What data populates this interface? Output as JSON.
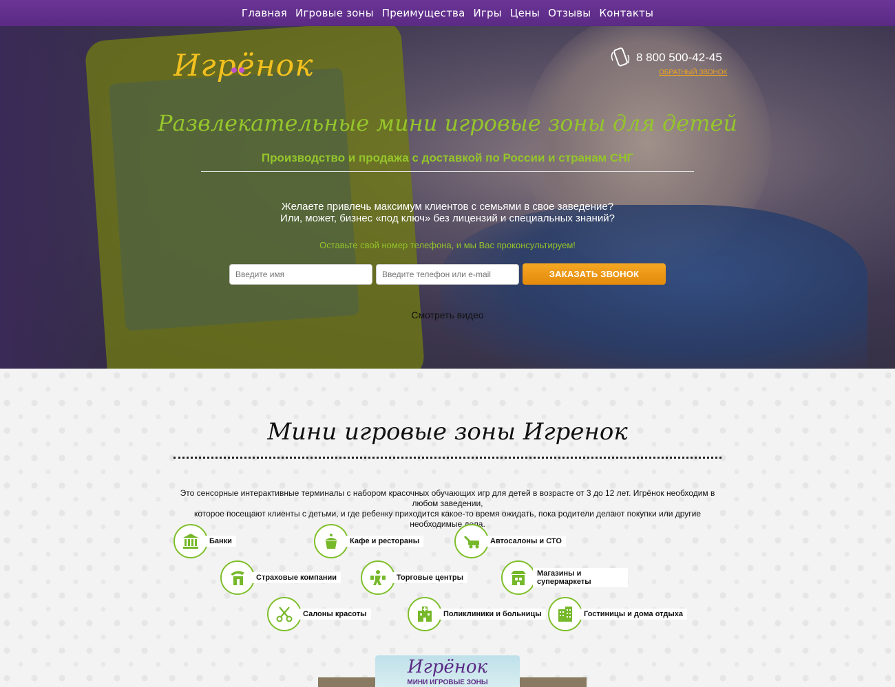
{
  "nav": {
    "items": [
      "Главная",
      "Игровые зоны",
      "Преимущества",
      "Игры",
      "Цены",
      "Отзывы",
      "Контакты"
    ]
  },
  "header": {
    "logo_text": "Игрёнок",
    "phone": "8 800 500-42-45",
    "callback_link": "ОБРАТНЫЙ ЗВОНОК"
  },
  "hero": {
    "title": "Развлекательные мини игровые зоны для детей",
    "subtitle": "Производство и продажа с доставкой по России и странам СНГ",
    "question_line1": "Желаете привлечь максимум клиентов с семьями в свое заведение?",
    "question_line2": "Или, может, бизнес «под ключ» без лицензий и специальных знаний?",
    "hint": "Оставьте свой номер телефона, и мы Вас проконсультируем!",
    "name_placeholder": "Введите имя",
    "phone_placeholder": "Введите телефон или e-mail",
    "submit_label": "ЗАКАЗАТЬ ЗВОНОК",
    "video_link": "Смотреть видео"
  },
  "section": {
    "title": "Мини игровые зоны Игренок",
    "description_line1": "Это сенсорные интерактивные терминалы с набором красочных обучающих игр для детей в возрасте от 3 до 12 лет. Игрёнок необходим в любом заведении,",
    "description_line2": "которое посещают клиенты с детьми, и где ребенку приходится какое-то время ожидать, пока родители делают покупки или другие необходимые дела.",
    "categories": [
      {
        "label": "Банки",
        "icon": "bank-icon"
      },
      {
        "label": "Кафе и рестораны",
        "icon": "cupcake-icon"
      },
      {
        "label": "Автосалоны и СТО",
        "icon": "car-wrench-icon"
      },
      {
        "label": "Страховые компании",
        "icon": "insurance-icon"
      },
      {
        "label": "Торговые центры",
        "icon": "shopping-person-icon"
      },
      {
        "label": "Магазины и супермаркеты",
        "icon": "store-icon"
      },
      {
        "label": "Салоны красоты",
        "icon": "scissors-icon"
      },
      {
        "label": "Поликлиники и больницы",
        "icon": "hospital-icon"
      },
      {
        "label": "Гостиницы и дома отдыха",
        "icon": "hotel-icon"
      }
    ]
  },
  "promo": {
    "title": "Игрёнок",
    "subtitle": "МИНИ ИГРОВЫЕ ЗОНЫ"
  },
  "colors": {
    "nav_bg": "#5a2a84",
    "logo": "#f2c01f",
    "accent_green": "#95c52b",
    "button_orange": "#f29a16",
    "link_orange": "#f2a51f"
  }
}
